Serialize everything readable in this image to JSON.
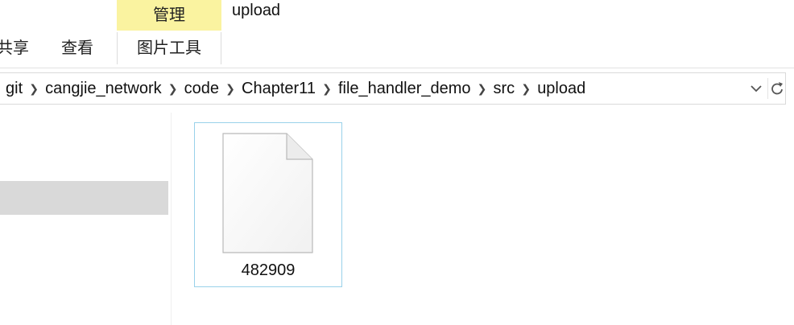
{
  "window": {
    "title": "upload"
  },
  "ribbon": {
    "tools_header": "管理",
    "tabs": [
      {
        "label": "共享"
      },
      {
        "label": "查看"
      },
      {
        "label": "图片工具"
      }
    ]
  },
  "address_bar": {
    "path": [
      {
        "label": "git"
      },
      {
        "label": "cangjie_network"
      },
      {
        "label": "code"
      },
      {
        "label": "Chapter11"
      },
      {
        "label": "file_handler_demo"
      },
      {
        "label": "src"
      },
      {
        "label": "upload"
      }
    ],
    "dropdown_icon": "chevron-down-icon",
    "refresh_icon": "refresh-icon"
  },
  "files": [
    {
      "name": "482909",
      "icon": "blank-file-icon"
    }
  ],
  "colors": {
    "tools_header_bg": "#faf3a0",
    "selection_border": "#99d1ea",
    "nav_selected_bg": "#d9d9d9"
  }
}
